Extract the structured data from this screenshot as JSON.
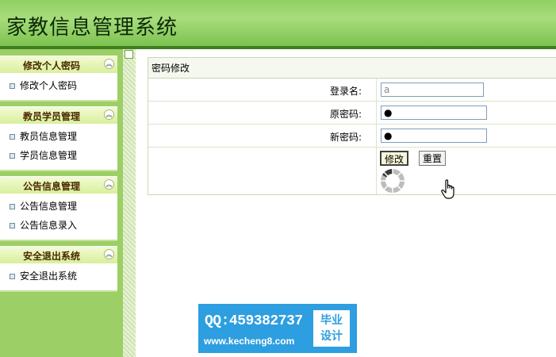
{
  "app": {
    "title": "家教信息管理系统"
  },
  "sidebar": {
    "groups": [
      {
        "title": "修改个人密码",
        "items": [
          "修改个人密码"
        ]
      },
      {
        "title": "教员学员管理",
        "items": [
          "教员信息管理",
          "学员信息管理"
        ]
      },
      {
        "title": "公告信息管理",
        "items": [
          "公告信息管理",
          "公告信息录入"
        ]
      },
      {
        "title": "安全退出系统",
        "items": [
          "安全退出系统"
        ]
      }
    ]
  },
  "panel": {
    "title": "密码修改",
    "fields": {
      "username": {
        "label": "登录名:",
        "value": "a"
      },
      "old_password": {
        "label": "原密码:",
        "value": "●"
      },
      "new_password": {
        "label": "新密码:",
        "value": "●"
      }
    },
    "buttons": {
      "submit": "修改",
      "reset": "重置"
    }
  },
  "watermark": {
    "qq": "QQ:459382737",
    "url": "www.kecheng8.com",
    "badge_line1": "毕业",
    "badge_line2": "设计"
  },
  "colors": {
    "header": "#8fd063",
    "sidebar": "#9ccf66",
    "watermark": "#2d9ee0"
  }
}
